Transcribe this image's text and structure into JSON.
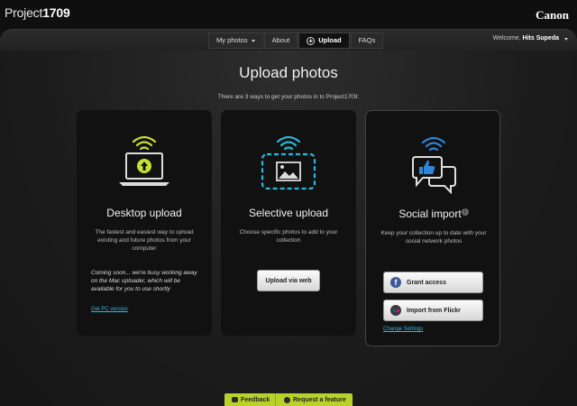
{
  "header": {
    "logo_prefix": "Project",
    "logo_number": "1709",
    "brand": "Canon"
  },
  "nav": {
    "my_photos": "My photos",
    "about": "About",
    "upload": "Upload",
    "faqs": "FAQs"
  },
  "user": {
    "welcome_prefix": "Welcome,",
    "name": "Hits Supeda"
  },
  "page": {
    "title": "Upload photos",
    "subtitle": "There are 3 ways to get your photos in to Project1709:"
  },
  "desktop": {
    "title": "Desktop upload",
    "description": "The fastest and easiest way to upload existing and future photos from your computer",
    "note": "Coming soon... we're busy working away on the Mac uploader, which will be available for you to use shortly",
    "link": "Get PC version"
  },
  "selective": {
    "title": "Selective upload",
    "description": "Choose specific photos to add to your collection",
    "button": "Upload via web"
  },
  "social": {
    "title": "Social import",
    "info_glyph": "i",
    "description": "Keep your collection up to date with your social network photos",
    "facebook_button": "Grant access",
    "facebook_glyph": "f",
    "flickr_button": "Import from Flickr",
    "link": "Change Settings"
  },
  "footer": {
    "feedback": "Feedback",
    "request": "Request a feature"
  },
  "colors": {
    "accent_green": "#b8d22a",
    "link_blue": "#35b8e4",
    "wifi_yellow": "#c8e032",
    "wifi_cyan": "#2bb7d8",
    "wifi_blue": "#2f86d8",
    "facebook_blue": "#3b5998",
    "flickr_blue": "#0063dc",
    "flickr_pink": "#ff0084"
  },
  "icons": {
    "desktop": "laptop-upload-icon",
    "selective": "photo-select-icon",
    "social": "social-chat-icon",
    "wifi": "wifi-signal-icon"
  }
}
